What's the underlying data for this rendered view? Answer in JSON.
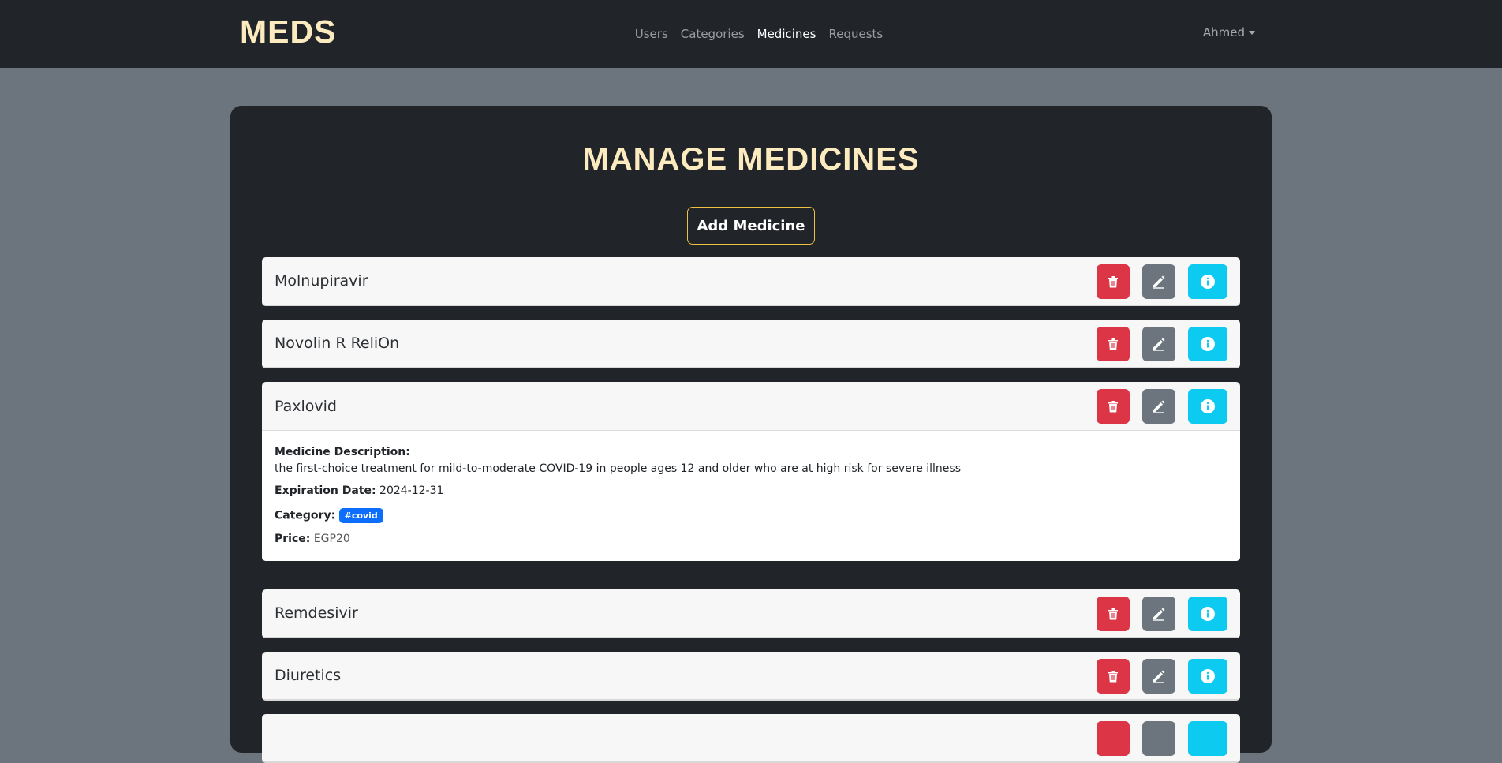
{
  "navbar": {
    "brand": "MEDS",
    "links": [
      {
        "label": "Users",
        "active": false
      },
      {
        "label": "Categories",
        "active": false
      },
      {
        "label": "Medicines",
        "active": true
      },
      {
        "label": "Requests",
        "active": false
      }
    ],
    "user": "Ahmed"
  },
  "page": {
    "title": "MANAGE MEDICINES",
    "add_button": "Add Medicine"
  },
  "medicines": [
    {
      "name": "Molnupiravir"
    },
    {
      "name": "Novolin R ReliOn"
    },
    {
      "name": "Paxlovid",
      "expanded": true,
      "description_label": "Medicine Description:",
      "description": "the first-choice treatment for mild-to-moderate COVID-19 in people ages 12 and older who are at high risk for severe illness",
      "expiration_label": "Expiration Date:",
      "expiration": "2024-12-31",
      "category_label": "Category:",
      "category": "#covid",
      "price_label": "Price:",
      "price": "EGP20"
    },
    {
      "name": "Remdesivir"
    },
    {
      "name": "Diuretics"
    },
    {
      "name": ""
    }
  ],
  "colors": {
    "delete": "#dc3545",
    "edit": "#6c757d",
    "info": "#0dcaf0",
    "accent": "#fdebc0"
  }
}
